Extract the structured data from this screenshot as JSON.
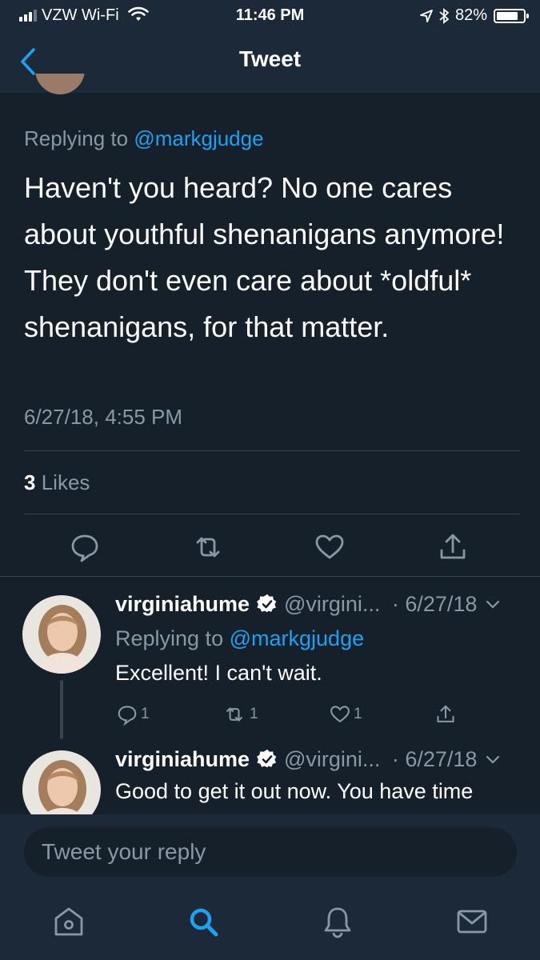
{
  "status_bar": {
    "carrier": "VZW Wi-Fi",
    "time": "11:46 PM",
    "battery": "82%",
    "battery_level": 0.82
  },
  "nav": {
    "title": "Tweet"
  },
  "tweet": {
    "replying_prefix": "Replying to",
    "replying_handle": "@markgjudge",
    "text": "Haven't you heard?  No one cares about youthful shenanigans anymore! They don't even care about *oldful* shenanigans, for that matter.",
    "timestamp": "6/27/18, 4:55 PM",
    "likes_count": "3",
    "likes_label": "Likes"
  },
  "replies": [
    {
      "name": "virginiahume",
      "handle": "@virgini...",
      "date": "· 6/27/18",
      "replying_prefix": "Replying to",
      "replying_handle": "@markgjudge",
      "text": "Excellent! I can't wait.",
      "reply_count": "1",
      "retweet_count": "1",
      "like_count": "1"
    },
    {
      "name": "virginiahume",
      "handle": "@virgini...",
      "date": "· 6/27/18",
      "text": "Good to get it out now. You have time"
    }
  ],
  "reply_box": {
    "placeholder": "Tweet your reply"
  },
  "colors": {
    "background": "#15202b",
    "bars": "#1c2938",
    "accent": "#1da1f2",
    "muted": "#8899a6",
    "verified": "#ffffff"
  },
  "icons": [
    "back-chevron-icon",
    "reply-icon",
    "retweet-icon",
    "like-icon",
    "share-icon",
    "verified-icon",
    "chevron-down-icon",
    "home-icon",
    "search-icon",
    "notifications-icon",
    "messages-icon"
  ]
}
